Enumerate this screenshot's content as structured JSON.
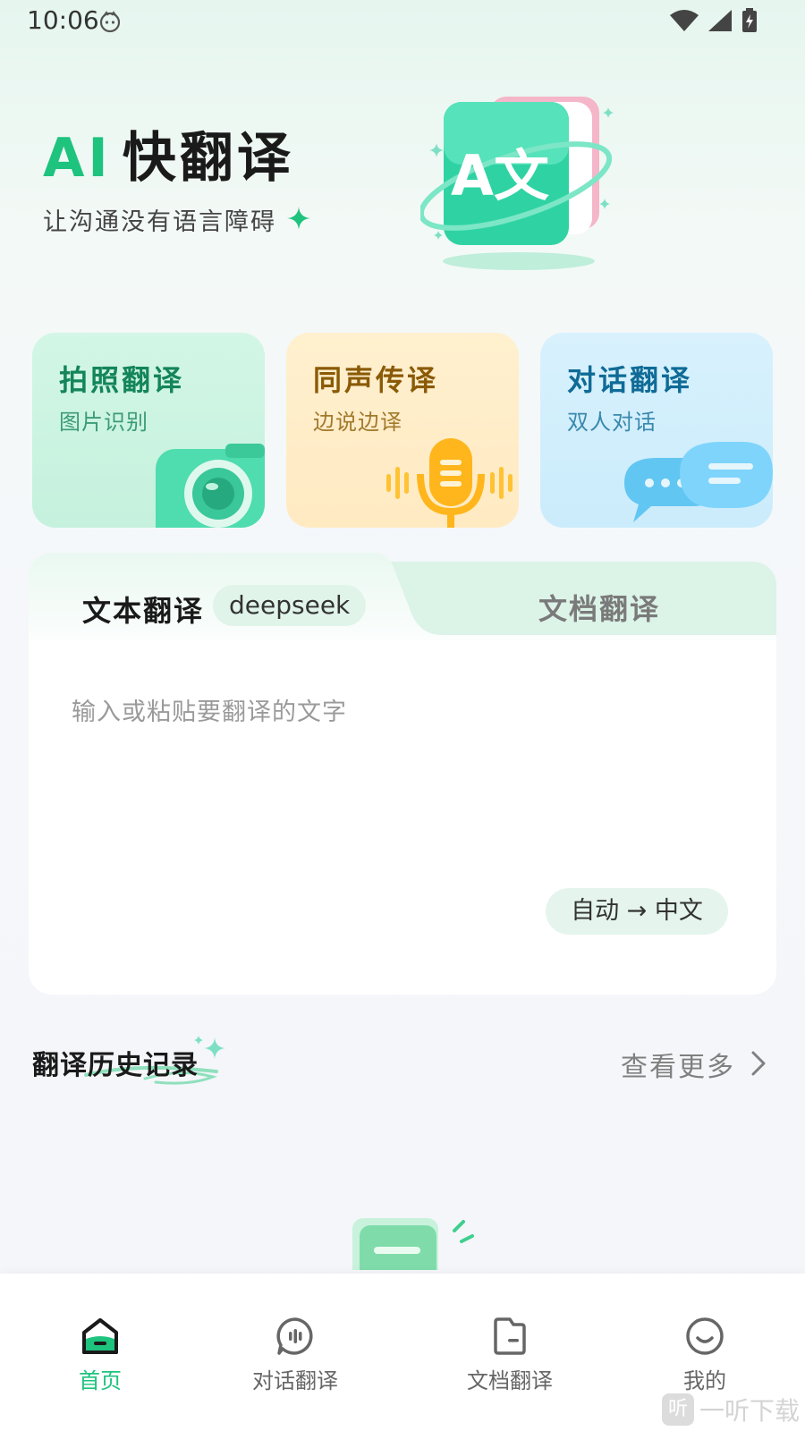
{
  "status_bar": {
    "time": "10:06",
    "icons": [
      "face-icon",
      "wifi-icon",
      "signal-icon",
      "battery-icon"
    ]
  },
  "hero": {
    "title_ai": "AI",
    "title_main": "快翻译",
    "slogan": "让沟通没有语言障碍",
    "illustration_text": "A文",
    "accent_color": "#1ec37e"
  },
  "features": [
    {
      "title": "拍照翻译",
      "subtitle": "图片识别",
      "icon": "camera-icon",
      "color": "#c5f1dd"
    },
    {
      "title": "同声传译",
      "subtitle": "边说边译",
      "icon": "microphone-icon",
      "color": "#ffeac2"
    },
    {
      "title": "对话翻译",
      "subtitle": "双人对话",
      "icon": "chat-bubbles-icon",
      "color": "#cbecfc"
    }
  ],
  "translate": {
    "tab_text": "文本翻译",
    "tab_badge": "deepseek",
    "tab_doc": "文档翻译",
    "placeholder": "输入或粘贴要翻译的文字",
    "language_pair": "自动 → 中文"
  },
  "history": {
    "title": "翻译历史记录",
    "more": "查看更多"
  },
  "bottom_nav": [
    {
      "label": "首页",
      "icon": "home-icon",
      "active": true
    },
    {
      "label": "对话翻译",
      "icon": "dialog-icon",
      "active": false
    },
    {
      "label": "文档翻译",
      "icon": "document-icon",
      "active": false
    },
    {
      "label": "我的",
      "icon": "profile-icon",
      "active": false
    }
  ],
  "watermark": {
    "badge": "听",
    "text": "一听下载"
  }
}
